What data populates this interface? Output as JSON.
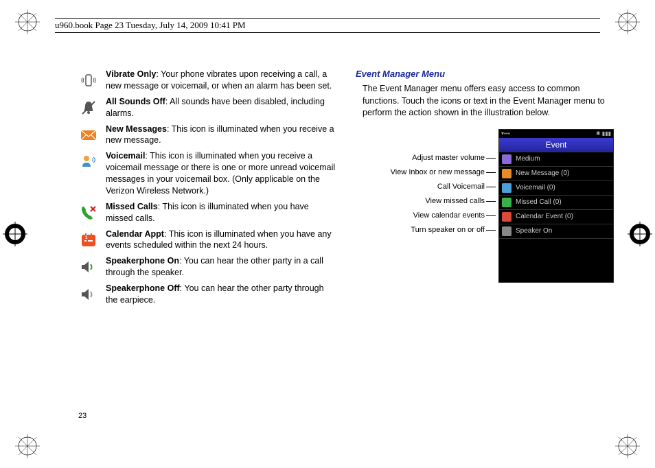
{
  "header": "u960.book  Page 23  Tuesday, July 14, 2009  10:41 PM",
  "page_number": "23",
  "icons": [
    {
      "title": "Vibrate Only",
      "desc": ": Your phone vibrates upon receiving a call, a new message or voicemail, or when an alarm has been set."
    },
    {
      "title": "All Sounds Off",
      "desc": ": All sounds have been disabled, including alarms."
    },
    {
      "title": "New Messages",
      "desc": ": This icon is illuminated when you receive a new message."
    },
    {
      "title": "Voicemail",
      "desc": ": This icon is illuminated when you receive a voicemail message or there is one or more unread voicemail messages in your voicemail box. (Only applicable on the Verizon Wireless Network.)"
    },
    {
      "title": "Missed Calls",
      "desc": ": This icon is illuminated when you have missed calls."
    },
    {
      "title": "Calendar Appt",
      "desc": ": This icon is illuminated when you have any events scheduled within the next 24 hours."
    },
    {
      "title": "Speakerphone On",
      "desc": ": You can hear the other party in a call through the speaker."
    },
    {
      "title": "Speakerphone Off",
      "desc": ": You can hear the other party through the earpiece."
    }
  ],
  "event_manager": {
    "title": "Event Manager Menu",
    "body": "The Event Manager menu offers easy access to common functions. Touch the icons or text in the Event Manager menu to perform the action shown in the illustration below.",
    "labels": [
      "Adjust master volume",
      "View Inbox or new message",
      "Call Voicemail",
      "View missed calls",
      "View calendar events",
      "Turn speaker on or off"
    ],
    "screen": {
      "title": "Event",
      "items": [
        {
          "color": "#8a6ad8",
          "text": "Medium"
        },
        {
          "color": "#e88a2a",
          "text": "New Message (0)"
        },
        {
          "color": "#4aa0d8",
          "text": "Voicemail (0)"
        },
        {
          "color": "#3ab04a",
          "text": "Missed Call (0)"
        },
        {
          "color": "#d84a3a",
          "text": "Calendar Event (0)"
        },
        {
          "color": "#888",
          "text": "Speaker On"
        }
      ]
    }
  }
}
